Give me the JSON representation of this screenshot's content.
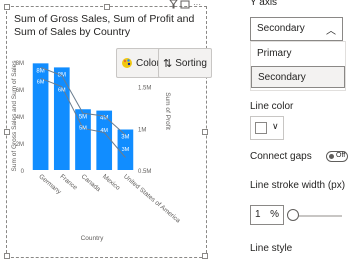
{
  "visual": {
    "title": "Sum of Gross Sales, Sum of Profit and Sum of Sales by Country",
    "colors_button": "Colors",
    "sorting_button": "Sorting"
  },
  "chart_data": {
    "type": "bar",
    "categories": [
      "Germany",
      "France",
      "Canada",
      "Mexico",
      "United States of America"
    ],
    "series": [
      {
        "name": "Sum of Gross Sales",
        "type": "bar",
        "values": [
          7.9,
          7.6,
          4.5,
          4.4,
          3.0
        ],
        "labels": [
          "8M",
          "8M",
          "5M",
          "4M",
          "3M"
        ]
      },
      {
        "name": "Sum of Profit",
        "type": "line",
        "axis": "secondary",
        "values": [
          1.6,
          1.5,
          1.0,
          0.95,
          0.65
        ]
      },
      {
        "name": "Sum of Sales",
        "type": "line",
        "values": [
          7.6,
          7.0,
          4.2,
          4.0,
          2.6
        ],
        "labels": [
          "6M",
          "6M",
          "5M",
          "4M",
          "3M"
        ]
      }
    ],
    "y_ticks": [
      "0",
      "2M",
      "4M",
      "6M",
      "8M"
    ],
    "y_title": "Sum of Gross Sales and Sum of Sales",
    "y2_ticks": [
      "0.5M",
      "1M",
      "1.5M"
    ],
    "y2_title": "Sum of Profit",
    "x_title": "Country",
    "colors": {
      "bar": "#118dff",
      "line": "#6b7d8f"
    }
  },
  "pane": {
    "axis_label": "Y axis",
    "select_value": "Secondary",
    "options": [
      "Primary",
      "Secondary"
    ],
    "line_color_label": "Line color",
    "connect_gaps_label": "Connect gaps",
    "connect_gaps_value": "Off",
    "stroke_label": "Line stroke width (px)",
    "stroke_value": "1",
    "stroke_unit": "%",
    "line_style_label": "Line style"
  }
}
